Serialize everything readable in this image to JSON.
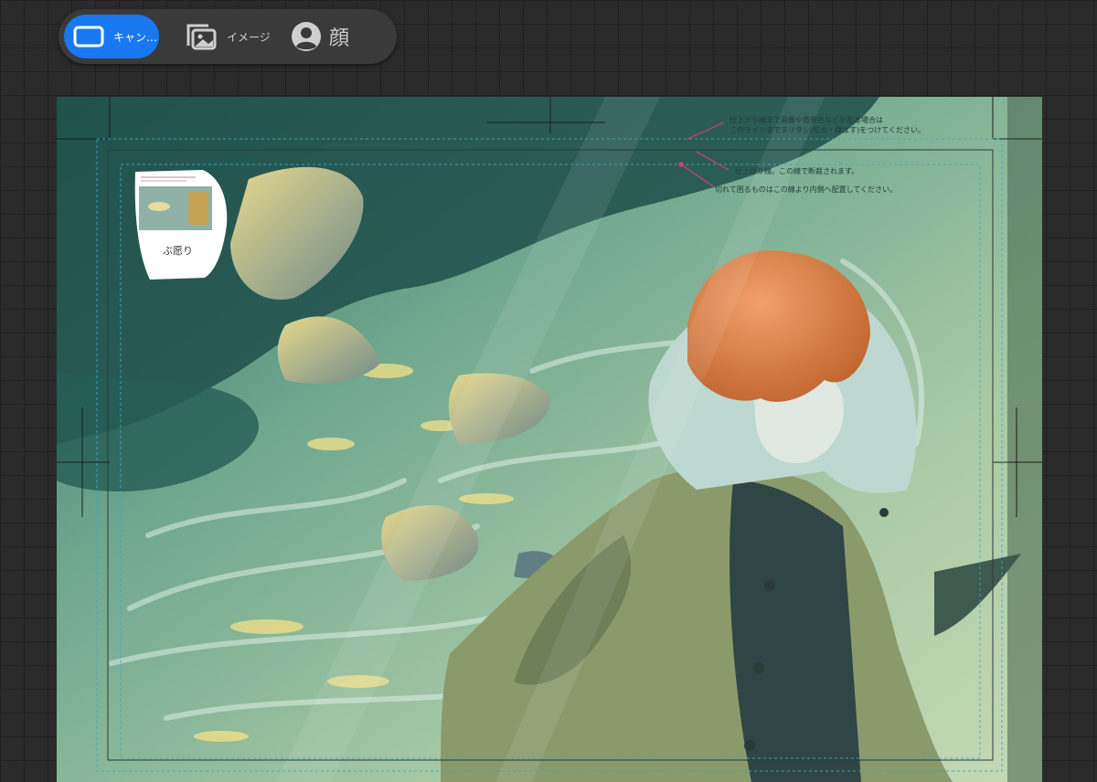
{
  "toolbar": {
    "canvas_label": "キャン…",
    "image_label": "イメージ",
    "face_label": "顔",
    "accent": "#1a78f2"
  },
  "guides": {
    "note_bleed_1": "仕上がり線まで画像や背景色などが左る場合は",
    "note_bleed_2": "このラインまでヌリタシ(拡大・縁ばす)をつけてください。",
    "note_trim": "仕上がり線。この線で断裁されます。",
    "note_safe": "切れて困るものはこの線より内側へ配置してください。"
  },
  "reference": {
    "caption": "ぶ愿り"
  },
  "icons": {
    "canvas": "canvas-icon",
    "image": "image-gallery-icon",
    "face": "person-icon"
  }
}
